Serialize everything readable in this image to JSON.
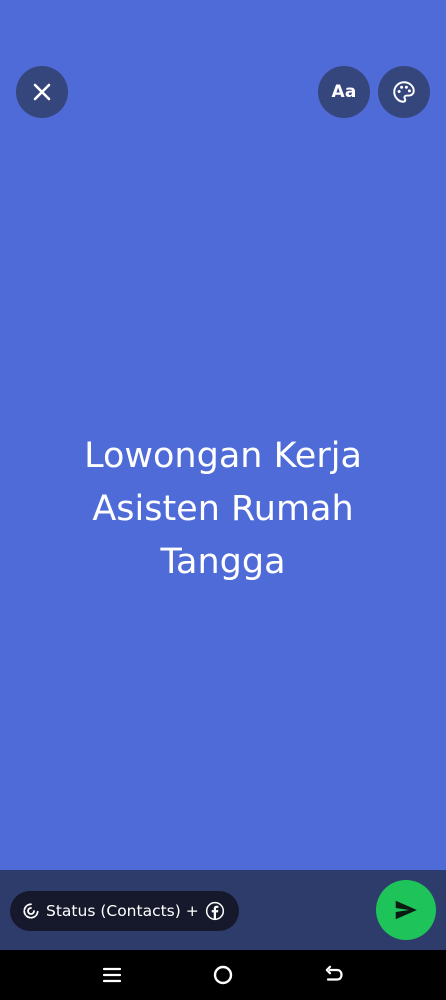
{
  "status_editor": {
    "text": "Lowongan Kerja Asisten Rumah Tangga",
    "background_color": "#4e6bd8",
    "top_bar": {
      "close_icon": "close-icon",
      "text_style_label": "Aa",
      "color_palette_icon": "palette-icon"
    }
  },
  "bottom_bar": {
    "audience_label": "Status (Contacts) +",
    "audience_icon": "status-icon",
    "share_target_icon": "facebook-icon",
    "send_icon": "send-icon",
    "send_color": "#1ec45a"
  },
  "nav_bar": {
    "recents_icon": "recents-icon",
    "home_icon": "home-icon",
    "back_icon": "back-icon"
  }
}
